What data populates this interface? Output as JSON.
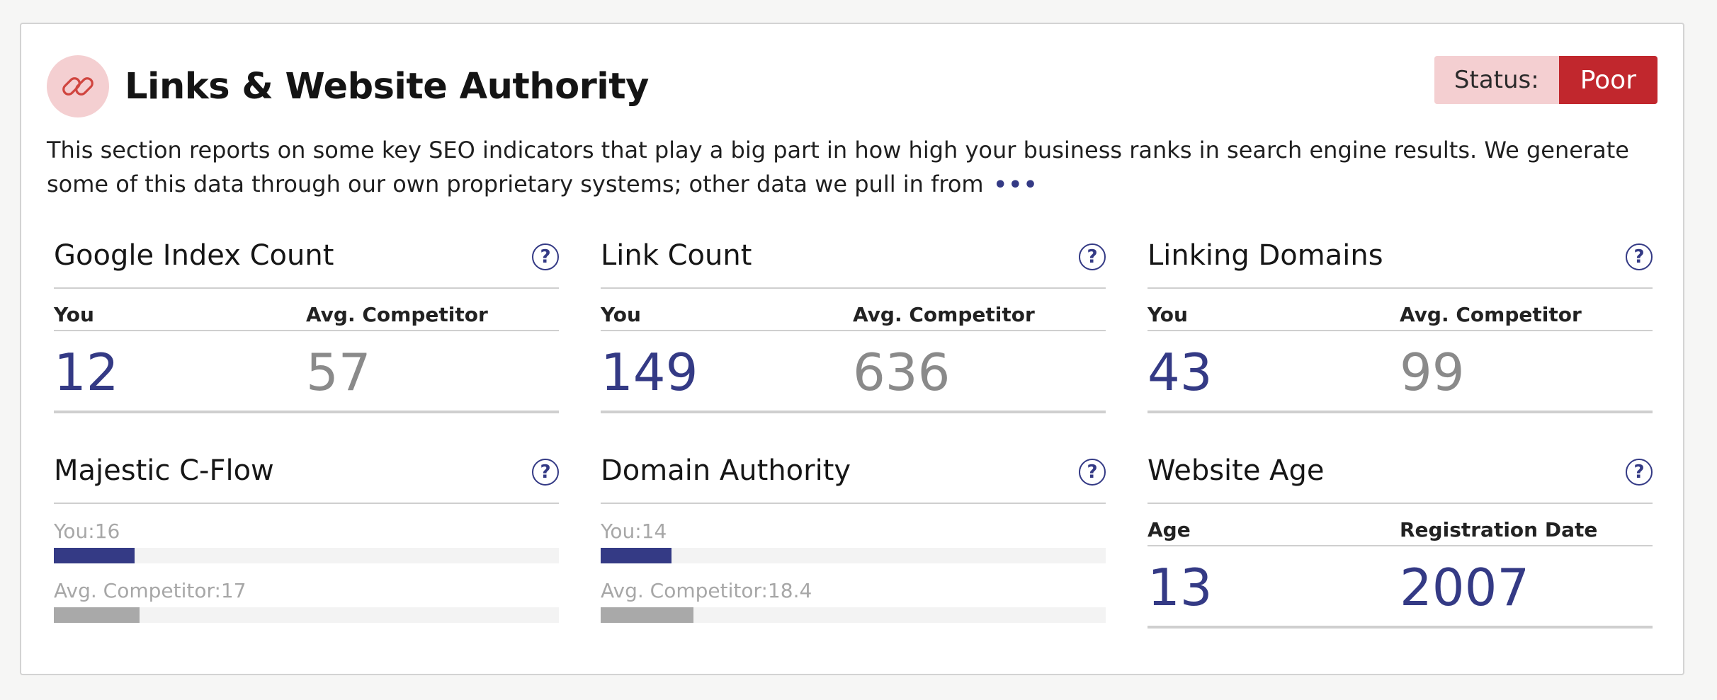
{
  "section": {
    "title": "Links & Website Authority",
    "status_label": "Status:",
    "status_value": "Poor",
    "description": "This section reports on some key SEO indicators that play a big part in how high your business ranks in search engine results. We generate some of this data through our own proprietary systems; other data we pull in from",
    "more": "•••"
  },
  "metrics": {
    "google_index": {
      "title": "Google Index Count",
      "col_you": "You",
      "col_avg": "Avg. Competitor",
      "you": "12",
      "avg": "57"
    },
    "link_count": {
      "title": "Link Count",
      "col_you": "You",
      "col_avg": "Avg. Competitor",
      "you": "149",
      "avg": "636"
    },
    "linking_domains": {
      "title": "Linking Domains",
      "col_you": "You",
      "col_avg": "Avg. Competitor",
      "you": "43",
      "avg": "99"
    },
    "majestic": {
      "title": "Majestic C-Flow",
      "you_label": "You:16",
      "avg_label": "Avg. Competitor:17",
      "you_value": 16,
      "avg_value": 17
    },
    "domain_authority": {
      "title": "Domain Authority",
      "you_label": "You:14",
      "avg_label": "Avg. Competitor:18.4",
      "you_value": 14,
      "avg_value": 18.4
    },
    "website_age": {
      "title": "Website Age",
      "col_age": "Age",
      "col_reg": "Registration Date",
      "age": "13",
      "reg": "2007"
    }
  },
  "icons": {
    "badge": "link-icon",
    "help": "question-icon",
    "more": "ellipsis-icon"
  },
  "colors": {
    "accent": "#343a85",
    "status_poor": "#c1272d",
    "badge_bg": "#f4cfd1"
  }
}
